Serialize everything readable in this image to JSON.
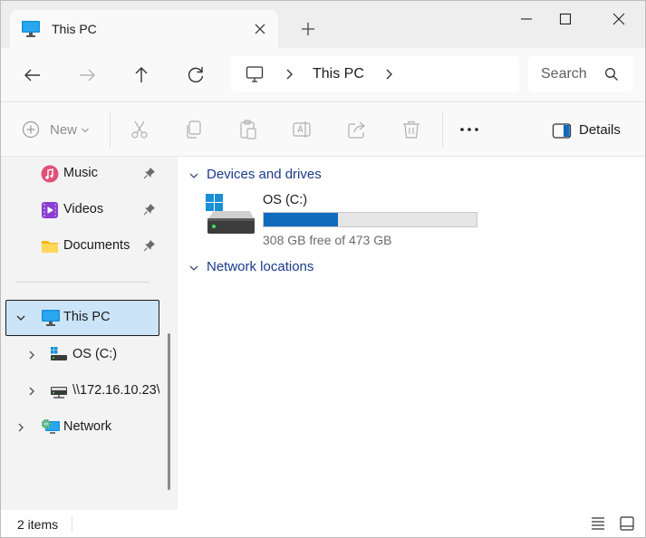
{
  "tab": {
    "title": "This PC"
  },
  "address": {
    "segment": "This PC"
  },
  "search": {
    "placeholder": "Search This PC"
  },
  "commandbar": {
    "new_label": "New",
    "details_label": "Details"
  },
  "sidebar": {
    "items": [
      {
        "label": "Music"
      },
      {
        "label": "Videos"
      },
      {
        "label": "Documents"
      },
      {
        "label": "This PC"
      },
      {
        "label": "OS (C:)"
      },
      {
        "label": "\\\\172.16.10.23\\"
      },
      {
        "label": "Network"
      }
    ]
  },
  "content": {
    "groups": [
      {
        "label": "Devices and drives"
      },
      {
        "label": "Network locations"
      }
    ],
    "drive": {
      "name": "OS (C:)",
      "free_text": "308 GB free of 473 GB",
      "used_fraction": 0.349
    }
  },
  "status": {
    "items": "2 items"
  },
  "colors": {
    "accent": "#0f6cbd",
    "selection": "#cce4f7",
    "group_text": "#1b3a8a"
  }
}
